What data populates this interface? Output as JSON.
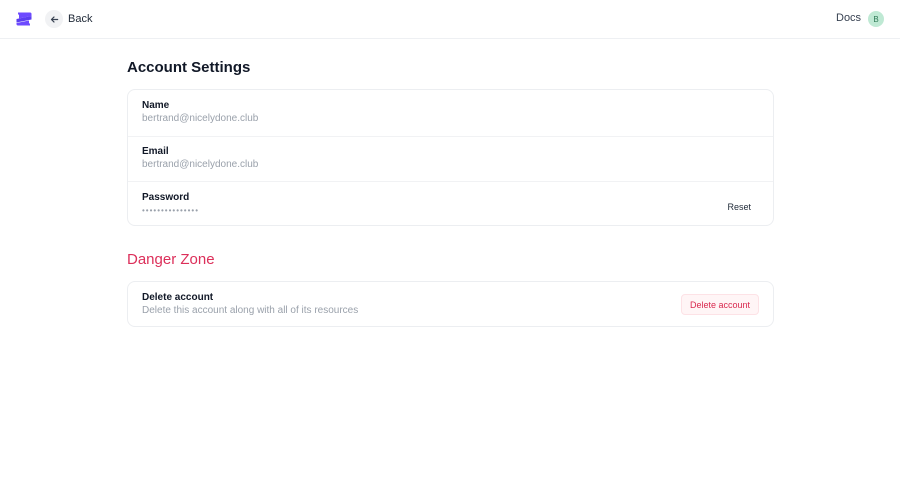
{
  "header": {
    "back_label": "Back",
    "docs_label": "Docs",
    "avatar_initial": "B"
  },
  "account_settings": {
    "title": "Account Settings",
    "rows": [
      {
        "label": "Name",
        "value": "bertrand@nicelydone.club"
      },
      {
        "label": "Email",
        "value": "bertrand@nicelydone.club"
      },
      {
        "label": "Password",
        "value": "•••••••••••••••",
        "action_label": "Reset"
      }
    ]
  },
  "danger_zone": {
    "title": "Danger Zone",
    "label": "Delete account",
    "description": "Delete this account along with all of its resources",
    "button_label": "Delete account"
  },
  "colors": {
    "brand": "#6d4aff",
    "danger": "#dc2f5a",
    "avatar_bg": "#bfe9d4"
  }
}
